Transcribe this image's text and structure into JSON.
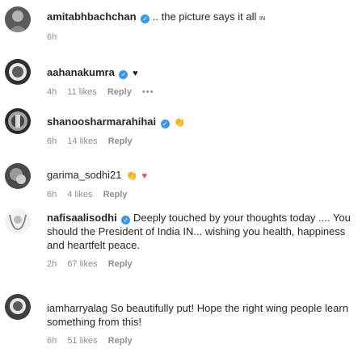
{
  "comments": [
    {
      "username": "amitabhbachchan",
      "text": ".. the picture says it all",
      "flag": "IN",
      "time": "6h",
      "likes": "",
      "reply": ""
    },
    {
      "username": "aahanakumra",
      "heart": "♥",
      "time": "4h",
      "likes": "11 likes",
      "reply": "Reply",
      "more": "•••"
    },
    {
      "username": "shanoosharmarahihai",
      "emoji": "👏",
      "time": "6h",
      "likes": "14 likes",
      "reply": "Reply"
    },
    {
      "username": "garima_sodhi21",
      "emoji": "👏",
      "heart": "♥",
      "time": "6h",
      "likes": "4 likes",
      "reply": "Reply"
    },
    {
      "username": "nafisaalisodhi",
      "text": "Deeply touched by your thoughts today .... You should the President of India IN... wishing you health, happiness and heartfelt peace.",
      "time": "2h",
      "likes": "67 likes",
      "reply": "Reply"
    },
    {
      "username": "iamharryalag",
      "text": "So beautifully put! Hope the right wing people learn something from this!",
      "time": "6h",
      "likes": "51 likes",
      "reply": "Reply"
    }
  ]
}
